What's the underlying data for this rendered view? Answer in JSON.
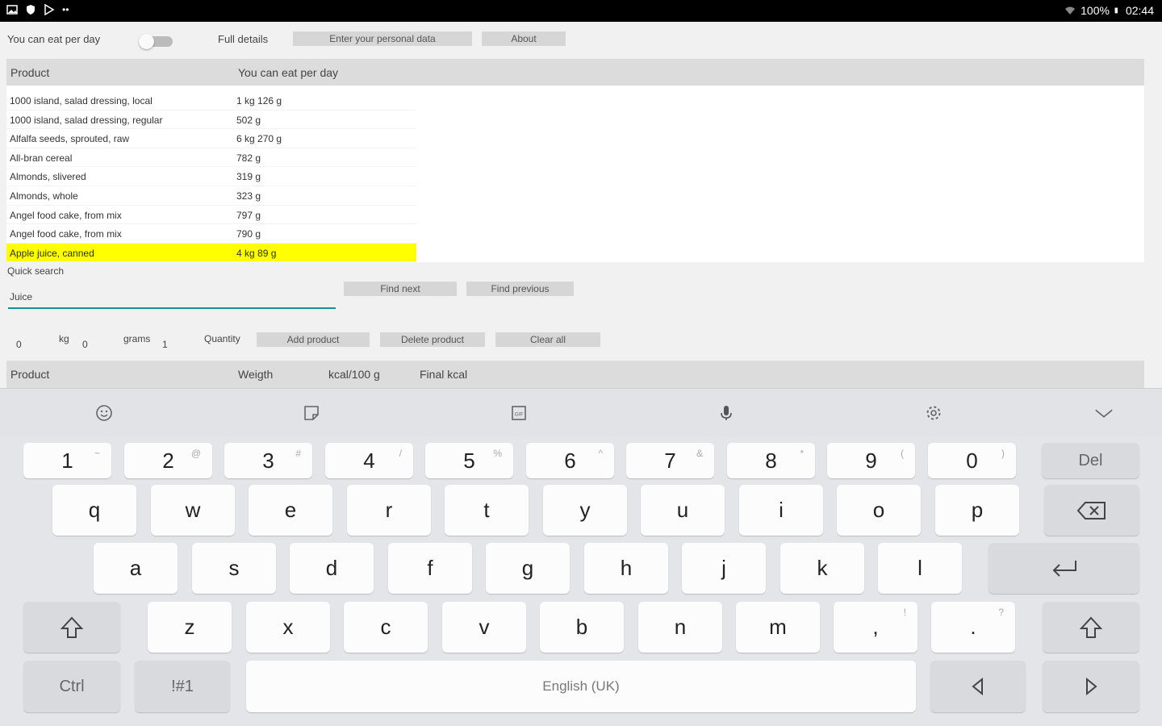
{
  "status": {
    "battery": "100%",
    "time": "02:44"
  },
  "top": {
    "toggle_label": "You can eat per day",
    "full_details": "Full details",
    "personal_data_btn": "Enter your personal data",
    "about_btn": "About"
  },
  "table": {
    "col_product": "Product",
    "col_eat": "You can eat per day",
    "rows": [
      {
        "product": "1000 island, salad dressing, local",
        "amount": "1 kg 126 g"
      },
      {
        "product": "1000 island, salad dressing, regular",
        "amount": "502 g"
      },
      {
        "product": "Alfalfa seeds, sprouted, raw",
        "amount": "6 kg 270 g"
      },
      {
        "product": "All-bran cereal",
        "amount": "782 g"
      },
      {
        "product": "Almonds, slivered",
        "amount": "319 g"
      },
      {
        "product": "Almonds, whole",
        "amount": "323 g"
      },
      {
        "product": "Angel food cake, from mix",
        "amount": "797 g"
      },
      {
        "product": "Angel food cake, from mix",
        "amount": "790 g"
      },
      {
        "product": "Apple juice, canned",
        "amount": "4 kg 89 g"
      }
    ],
    "selected_index": 8
  },
  "search": {
    "label": "Quick search",
    "value": "Juice",
    "find_next": "Find next",
    "find_previous": "Find previous"
  },
  "quantity": {
    "kg_value": "0",
    "kg_label": "kg",
    "grams_value": "0",
    "grams_label": "grams",
    "qty_value": "1",
    "qty_label": "Quantity",
    "add_btn": "Add product",
    "delete_btn": "Delete product",
    "clear_btn": "Clear all"
  },
  "table2": {
    "col_product": "Product",
    "col_weight": "Weigth",
    "col_kcal": "kcal/100 g",
    "col_final": "Final kcal"
  },
  "keyboard": {
    "numbers": [
      {
        "k": "1",
        "s": "~"
      },
      {
        "k": "2",
        "s": "@"
      },
      {
        "k": "3",
        "s": "#"
      },
      {
        "k": "4",
        "s": "/"
      },
      {
        "k": "5",
        "s": "%"
      },
      {
        "k": "6",
        "s": "^"
      },
      {
        "k": "7",
        "s": "&"
      },
      {
        "k": "8",
        "s": "*"
      },
      {
        "k": "9",
        "s": "("
      },
      {
        "k": "0",
        "s": ")"
      }
    ],
    "del": "Del",
    "row1": [
      "q",
      "w",
      "e",
      "r",
      "t",
      "y",
      "u",
      "i",
      "o",
      "p"
    ],
    "row2": [
      "a",
      "s",
      "d",
      "f",
      "g",
      "h",
      "j",
      "k",
      "l"
    ],
    "row3": [
      "z",
      "x",
      "c",
      "v",
      "b",
      "n",
      "m"
    ],
    "comma": ",",
    "comma_sub": "!",
    "period": ".",
    "period_sub": "?",
    "ctrl": "Ctrl",
    "sym": "!#1",
    "space": "English (UK)"
  }
}
